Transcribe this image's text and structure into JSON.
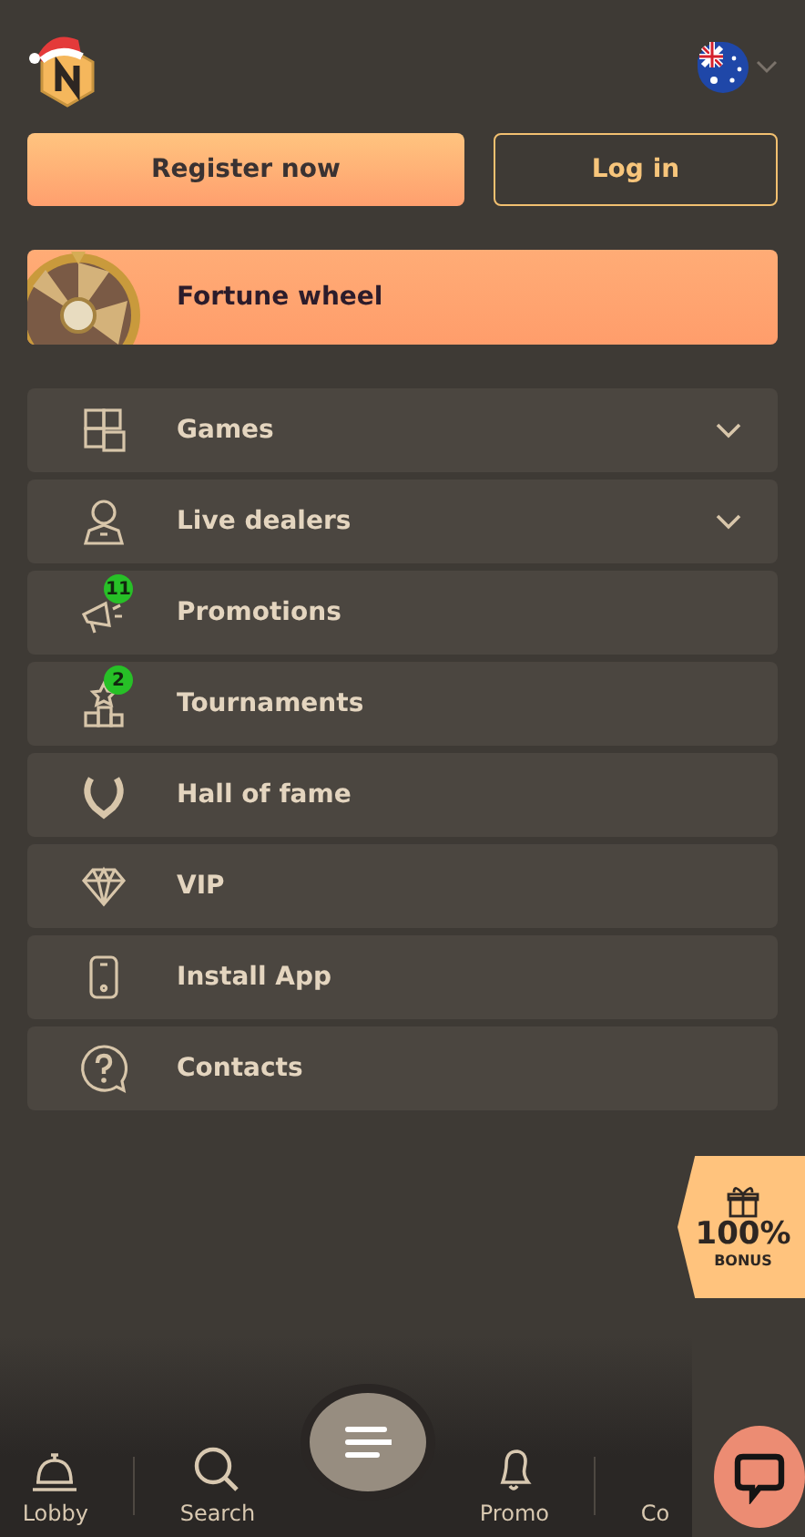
{
  "auth": {
    "register": "Register now",
    "login": "Log in"
  },
  "fortune": {
    "label": "Fortune wheel"
  },
  "menu": [
    {
      "label": "Games",
      "kind": "group"
    },
    {
      "label": "Live dealers",
      "kind": "group"
    },
    {
      "label": "Promotions",
      "kind": "link",
      "badge": "11"
    },
    {
      "label": "Tournaments",
      "kind": "link",
      "badge": "2"
    },
    {
      "label": "Hall of fame",
      "kind": "link"
    },
    {
      "label": "VIP",
      "kind": "link"
    },
    {
      "label": "Install App",
      "kind": "link"
    },
    {
      "label": "Contacts",
      "kind": "link"
    }
  ],
  "bonus": {
    "amount": "100%",
    "label": "BONUS"
  },
  "bottom_nav": [
    {
      "kind": "tab",
      "label": "Lobby"
    },
    {
      "kind": "tab",
      "label": "Search"
    },
    {
      "kind": "menu"
    },
    {
      "kind": "tab",
      "label": "Promo"
    },
    {
      "kind": "tab",
      "label": "Co"
    }
  ]
}
